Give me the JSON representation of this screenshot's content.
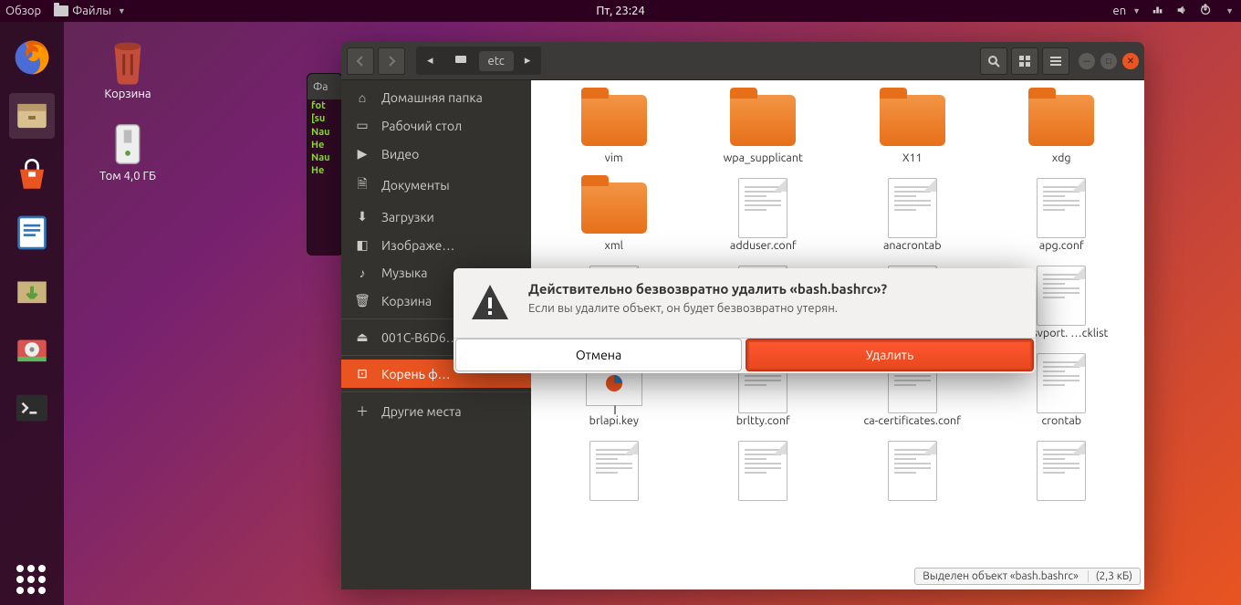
{
  "panel": {
    "overview": "Обзор",
    "files_menu": "Файлы",
    "clock": "Пт, 23:24",
    "lang": "en"
  },
  "desktop": {
    "trash": "Корзина",
    "volume": "Том 4,0 ГБ"
  },
  "terminal": {
    "title_short": "Фа",
    "lines": "fot\n[su\nNau\nНе\nNau\nНе"
  },
  "files": {
    "path": {
      "current": "etc"
    },
    "sidebar": {
      "items": [
        {
          "icon": "home",
          "label": "Домашняя папка"
        },
        {
          "icon": "desktop",
          "label": "Рабочий стол"
        },
        {
          "icon": "video",
          "label": "Видео"
        },
        {
          "icon": "documents",
          "label": "Документы"
        },
        {
          "icon": "downloads",
          "label": "Загрузки"
        },
        {
          "icon": "pictures",
          "label": "Изображе…"
        },
        {
          "icon": "music",
          "label": "Музыка"
        },
        {
          "icon": "trash",
          "label": "Корзина"
        }
      ],
      "device": "001C-B6D6…",
      "root": "Корень ф…",
      "other": "Другие места"
    },
    "grid": [
      {
        "type": "folder",
        "name": "vim"
      },
      {
        "type": "folder",
        "name": "wpa_supplicant"
      },
      {
        "type": "folder",
        "name": "X11"
      },
      {
        "type": "folder",
        "name": "xdg"
      },
      {
        "type": "folder",
        "name": "xml"
      },
      {
        "type": "doc",
        "name": "adduser.conf"
      },
      {
        "type": "doc",
        "name": "anacrontab"
      },
      {
        "type": "doc",
        "name": "apg.conf"
      },
      {
        "type": "doc",
        "name": ""
      },
      {
        "type": "doc",
        "name": ""
      },
      {
        "type": "doc",
        "name": ""
      },
      {
        "type": "doc",
        "name": "…esvport.\n…cklist"
      },
      {
        "type": "presentation",
        "name": "brlapi.key"
      },
      {
        "type": "doc",
        "name": "brltty.conf"
      },
      {
        "type": "doc",
        "name": "ca-certificates.conf"
      },
      {
        "type": "doc",
        "name": "crontab"
      },
      {
        "type": "doc",
        "name": ""
      },
      {
        "type": "doc",
        "name": ""
      },
      {
        "type": "doc",
        "name": ""
      },
      {
        "type": "doc",
        "name": ""
      }
    ],
    "status": {
      "text": "Выделен объект «bash.bashrc»",
      "size": "(2,3 кБ)"
    }
  },
  "dialog": {
    "title": "Действительно безвозвратно удалить «bash.bashrc»?",
    "desc": "Если вы удалите объект, он будет безвозвратно утерян.",
    "cancel": "Отмена",
    "delete": "Удалить"
  }
}
